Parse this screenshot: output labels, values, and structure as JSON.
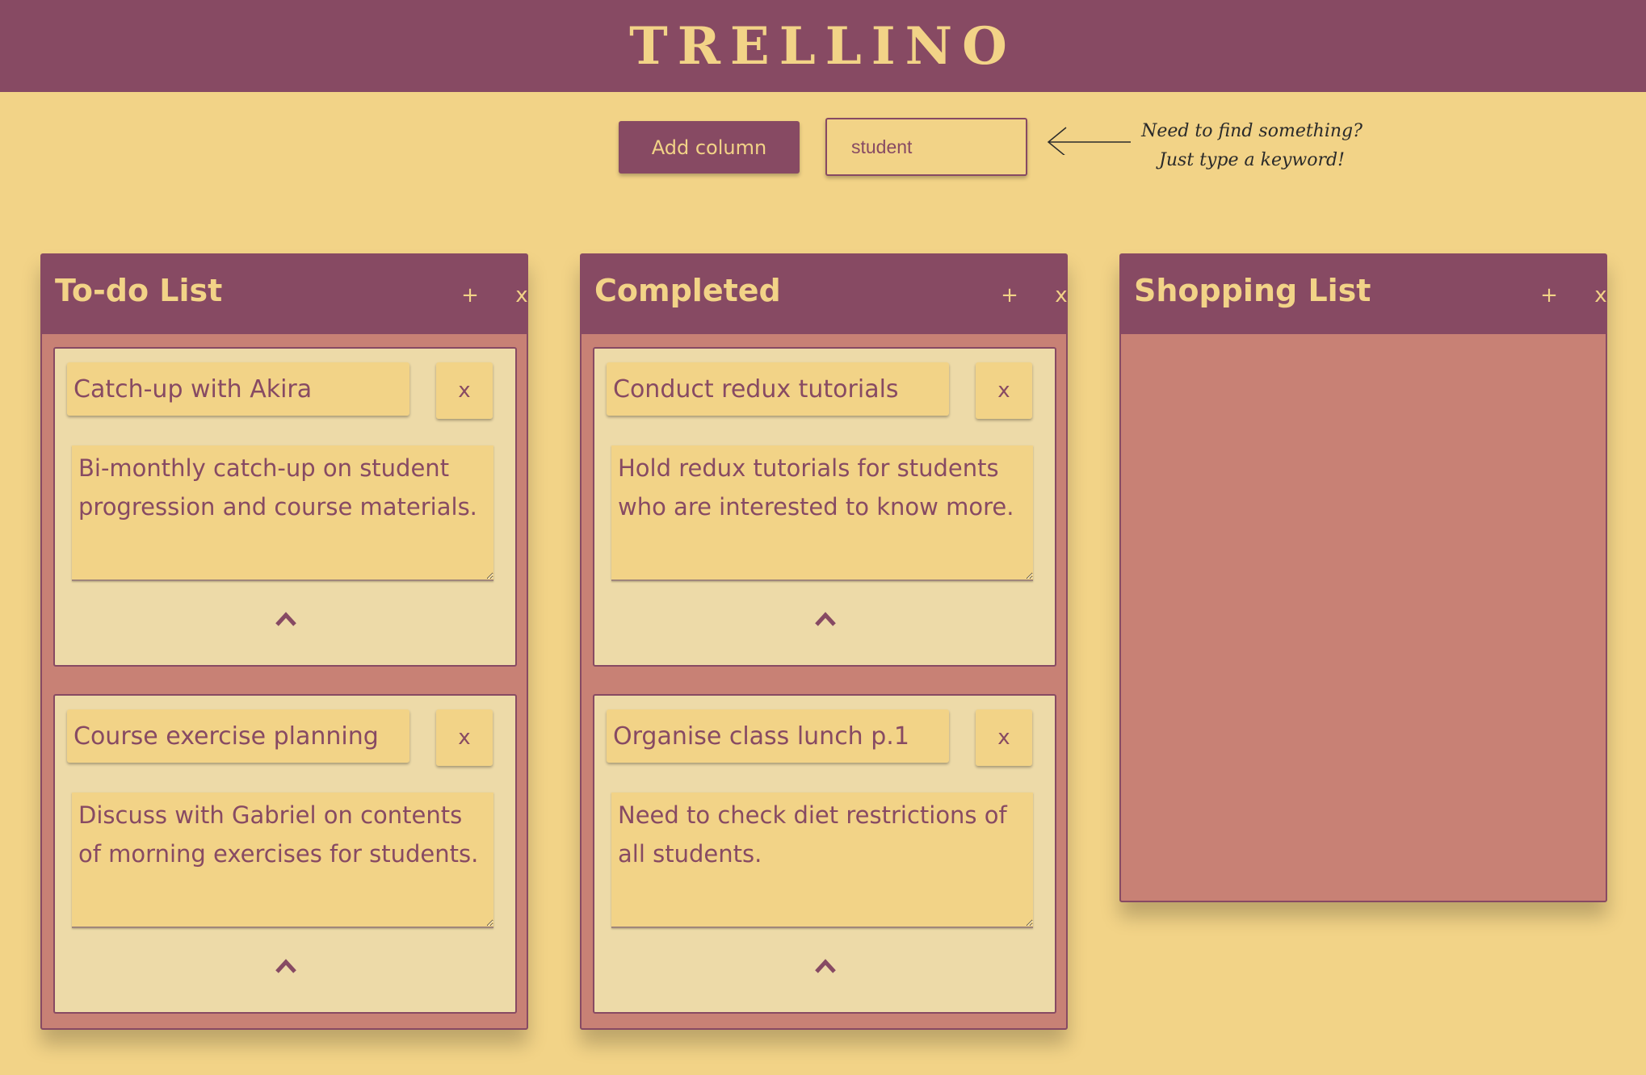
{
  "app": {
    "title": "TRELLINO"
  },
  "toolbar": {
    "add_column_label": "Add column",
    "search_value": "student",
    "hint_line1": "Need to find something?",
    "hint_line2": "Just type a keyword!"
  },
  "columns": [
    {
      "title": "To-do List",
      "add_label": "+",
      "delete_label": "x",
      "cards": [
        {
          "title": "Catch-up with Akira",
          "delete_label": "x",
          "description": "Bi-monthly catch-up on student progression and course materials."
        },
        {
          "title": "Course exercise planning",
          "delete_label": "x",
          "description": "Discuss with Gabriel on contents of morning exercises for students."
        }
      ]
    },
    {
      "title": "Completed",
      "add_label": "+",
      "delete_label": "x",
      "cards": [
        {
          "title": "Conduct redux tutorials",
          "delete_label": "x",
          "description": "Hold redux tutorials for students who are interested to know more."
        },
        {
          "title": "Organise class lunch p.1",
          "delete_label": "x",
          "description": "Need to check diet restrictions of all students."
        }
      ]
    },
    {
      "title": "Shopping List",
      "add_label": "+",
      "delete_label": "x",
      "cards": []
    }
  ],
  "colors": {
    "primary": "#874a63",
    "background": "#f2d387",
    "column_body": "#c88175",
    "card": "#eddaa8"
  },
  "icons": {
    "card_move": "chevron-up-icon",
    "hint": "arrow-left-icon"
  }
}
